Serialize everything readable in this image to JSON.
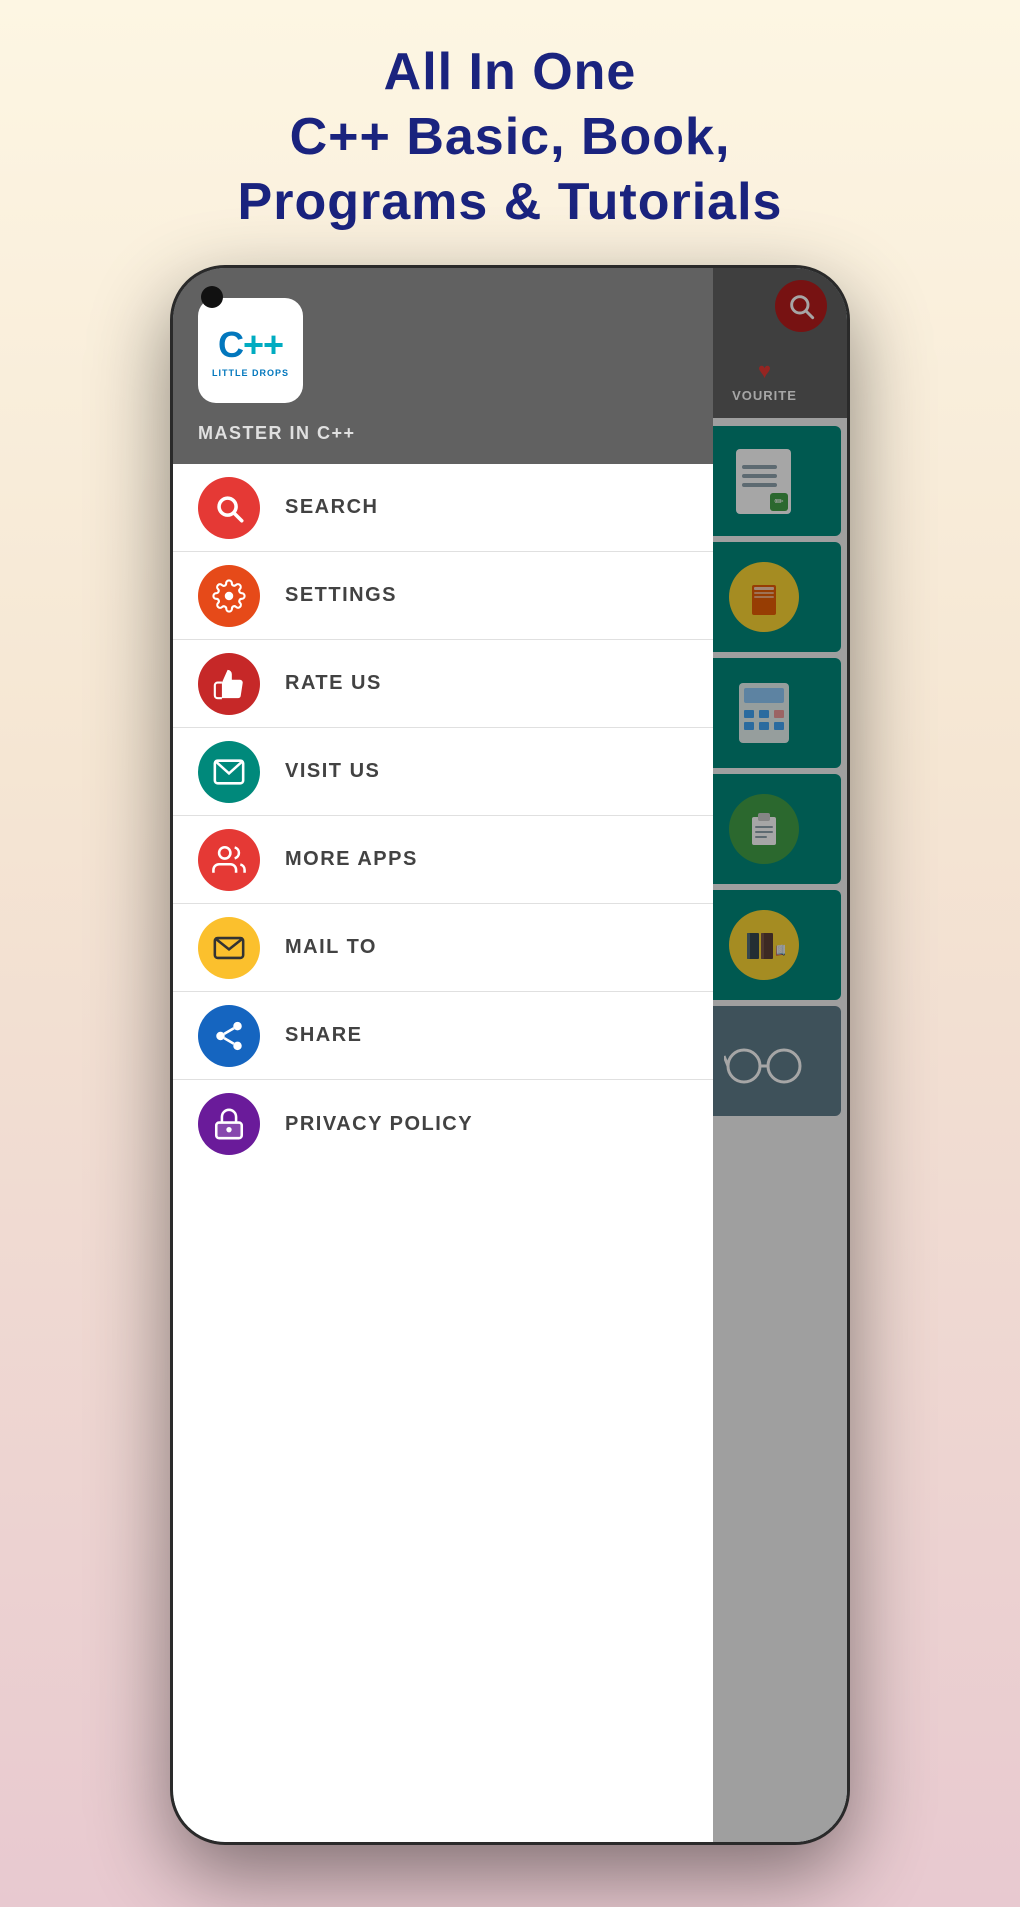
{
  "header": {
    "line1": "All In One",
    "line2": "C++ Basic, Book,",
    "line3": "Programs & Tutorials"
  },
  "app": {
    "logo_text": "C++",
    "logo_sub": "LITTLE DROPS",
    "app_name": "MASTER IN C++",
    "search_btn_label": "Search",
    "favourite_label": "VOURITE"
  },
  "drawer": {
    "items": [
      {
        "id": "search",
        "label": "SEARCH",
        "icon_color": "icon-red",
        "icon": "🔍"
      },
      {
        "id": "settings",
        "label": "SETTINGS",
        "icon_color": "icon-orange-red",
        "icon": "⚙️"
      },
      {
        "id": "rate-us",
        "label": "RATE US",
        "icon_color": "icon-red2",
        "icon": "👍"
      },
      {
        "id": "visit-us",
        "label": "VISIT US",
        "icon_color": "icon-teal",
        "icon": "🖥️"
      },
      {
        "id": "more-apps",
        "label": "MORE APPS",
        "icon_color": "icon-red3",
        "icon": "📱"
      },
      {
        "id": "mail-to",
        "label": "MAIL TO",
        "icon_color": "icon-yellow",
        "icon": "✉️"
      },
      {
        "id": "share",
        "label": "SHARE",
        "icon_color": "icon-blue",
        "icon": "🔗"
      },
      {
        "id": "privacy-policy",
        "label": "PRIVACY POLICY",
        "icon_color": "icon-purple",
        "icon": "🔒"
      }
    ]
  },
  "content_cards": [
    {
      "id": "card1",
      "bg": "#00897b",
      "icon_type": "document"
    },
    {
      "id": "card2",
      "bg": "#00897b",
      "icon_type": "book_circle"
    },
    {
      "id": "card3",
      "bg": "#00897b",
      "icon_type": "calc"
    },
    {
      "id": "card4",
      "bg": "#00897b",
      "icon_type": "clipboard"
    },
    {
      "id": "card5",
      "bg": "#00897b",
      "icon_type": "book"
    },
    {
      "id": "card6",
      "bg": "#607d8b",
      "icon_type": "glasses"
    }
  ]
}
